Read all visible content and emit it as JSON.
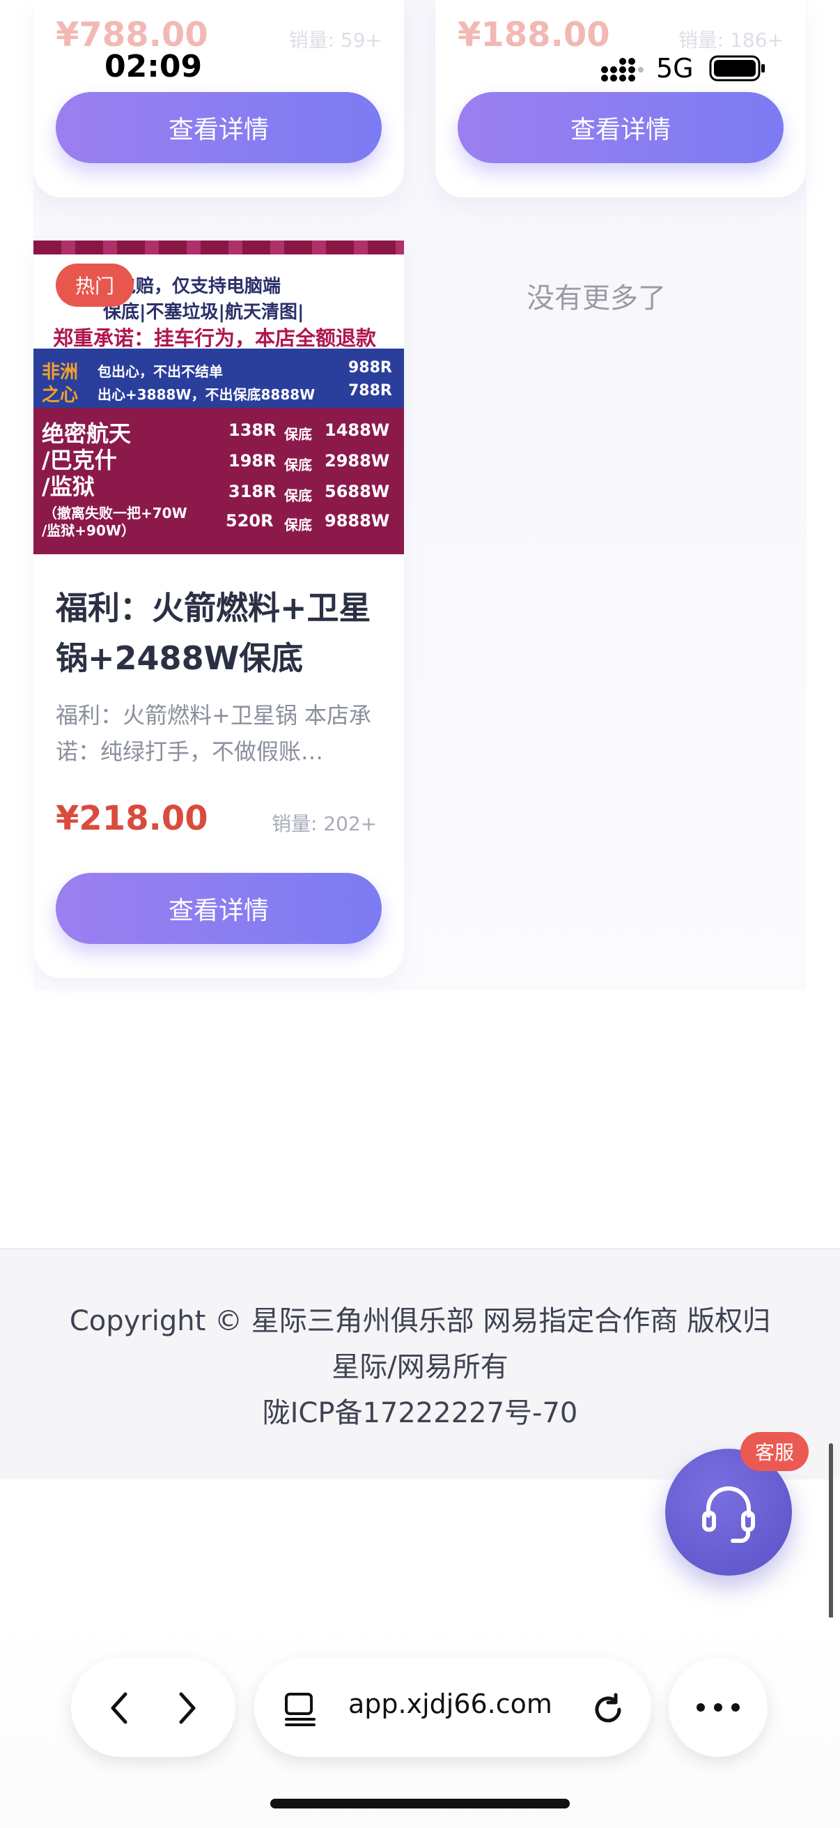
{
  "status_bar": {
    "time": "02:09",
    "network": "5G"
  },
  "products_top": [
    {
      "price": "¥788.00",
      "sales": "销量: 59+",
      "button": "查看详情"
    },
    {
      "price": "¥188.00",
      "sales": "销量: 186+",
      "button": "查看详情"
    }
  ],
  "product_main": {
    "badge": "热门",
    "image_text": {
      "line1": "缴包赔，仅支持电脑端",
      "line2": "保底|不塞垃圾|航天清图|",
      "line3": "郑重承诺：挂车行为，本店全额退款",
      "africa_label_1": "非洲",
      "africa_label_2": "之心",
      "africa_line1": "包出心，不出不结单",
      "africa_price1": "988R",
      "africa_line2": "出心+3888W，不出保底8888W",
      "africa_price2": "788R",
      "left_1": "绝密航天",
      "left_2": "/巴克什",
      "left_3": "/监狱",
      "left_4": "（撤离失败一把+70W",
      "left_5": "/监狱+90W）",
      "rows": [
        {
          "price": "138R",
          "tag": "保底",
          "amount": "1488W"
        },
        {
          "price": "198R",
          "tag": "保底",
          "amount": "2988W"
        },
        {
          "price": "318R",
          "tag": "保底",
          "amount": "5688W"
        },
        {
          "price": "520R",
          "tag": "保底",
          "amount": "9888W"
        }
      ]
    },
    "title": "福利：火箭燃料+卫星锅+2488W保底",
    "description": "福利：火箭燃料+卫星锅 本店承诺：纯绿打手，不做假账…",
    "price": "¥218.00",
    "sales": "销量: 202+",
    "button": "查看详情"
  },
  "no_more": "没有更多了",
  "footer": {
    "line1": "Copyright © 星际三角州俱乐部 网易指定合作商 版权归",
    "line2": "星际/网易所有",
    "line3": "陇ICP备17222227号-70"
  },
  "chat": {
    "badge": "客服",
    "icon": "headset-icon"
  },
  "browser": {
    "url": "app.xjdj66.com"
  },
  "colors": {
    "accent": "#8b7ff0",
    "price": "#d94b3e",
    "badge": "#e8574e"
  }
}
